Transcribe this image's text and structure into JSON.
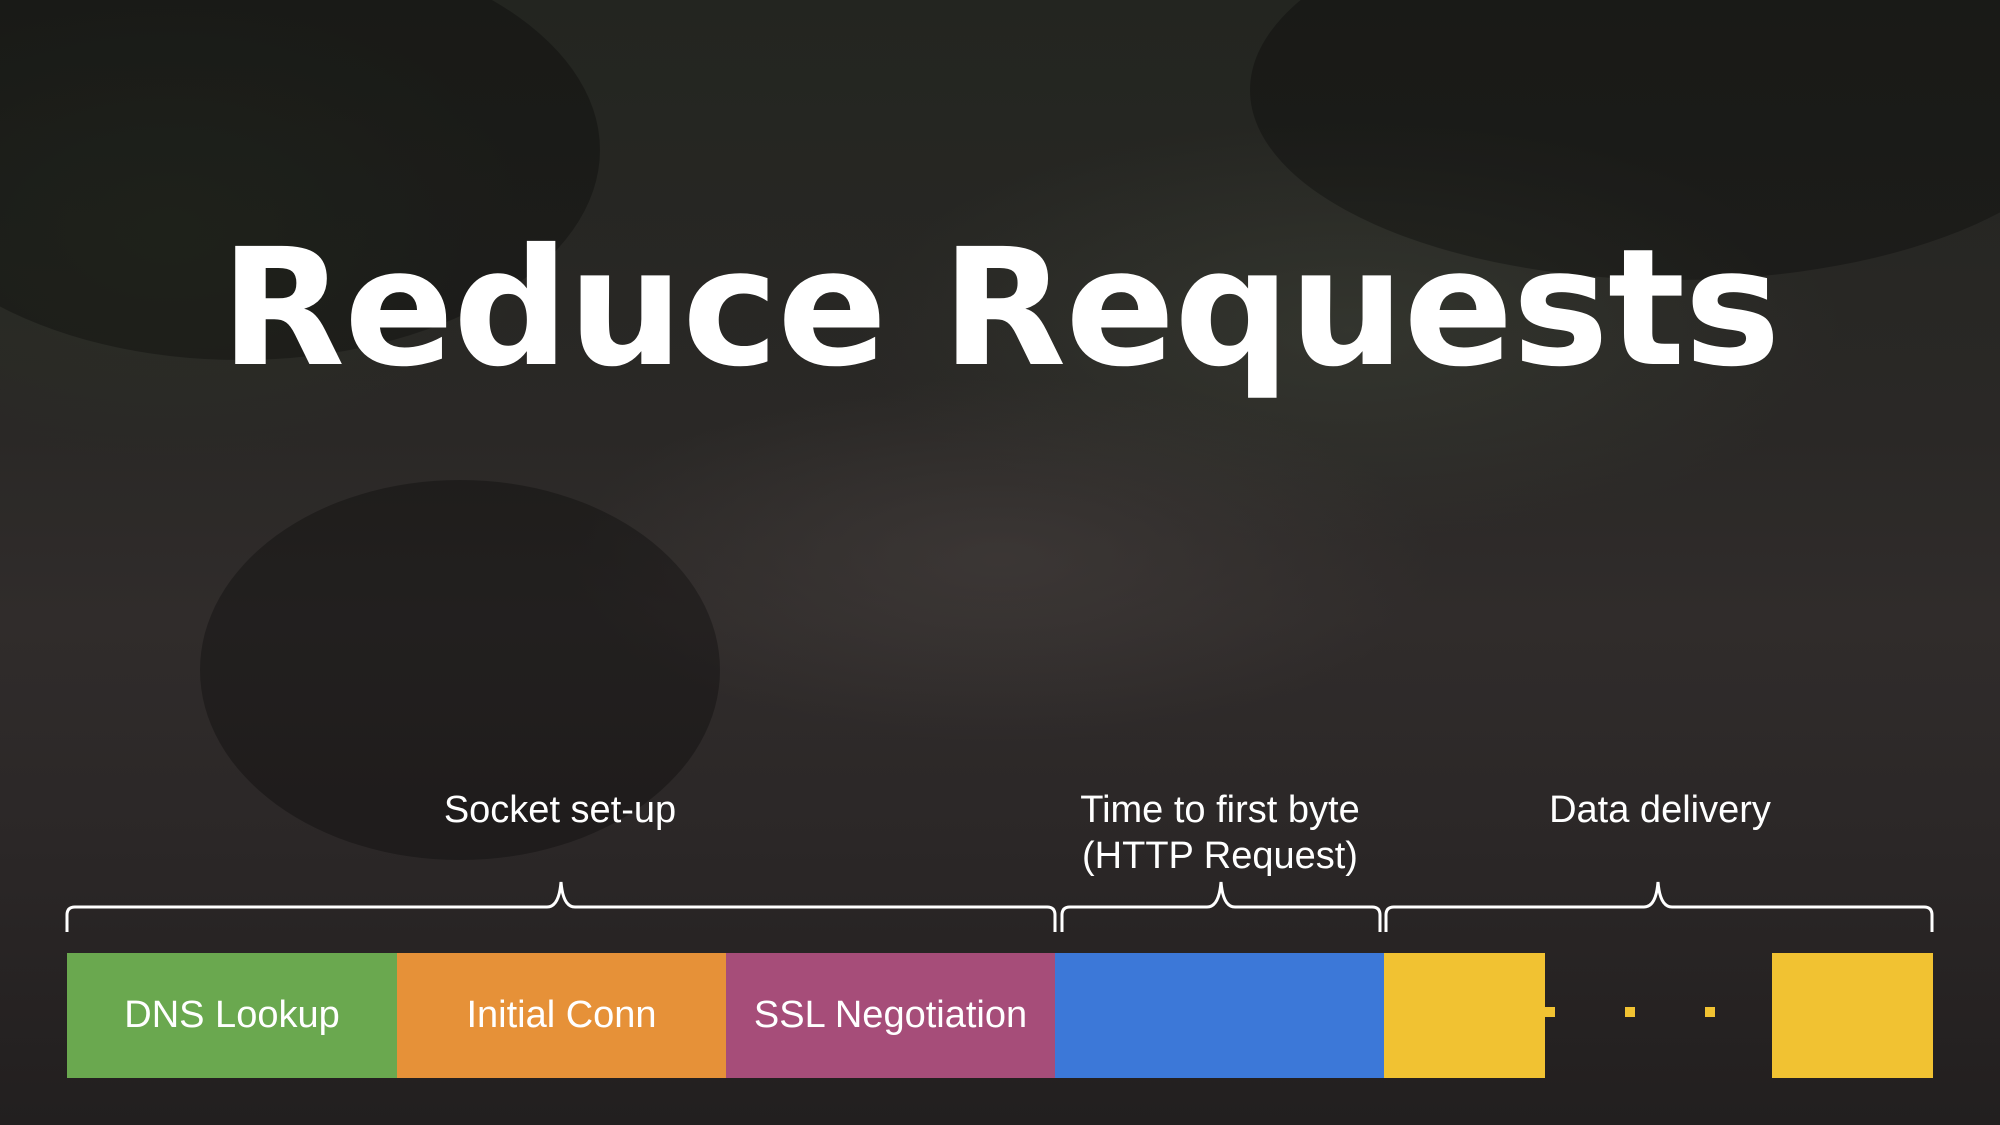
{
  "slide": {
    "title": "Reduce Requests"
  },
  "phases": [
    {
      "label": "Socket set-up"
    },
    {
      "label_line1": "Time to first byte",
      "label_line2": "(HTTP Request)"
    },
    {
      "label": "Data delivery"
    }
  ],
  "bars": [
    {
      "label": "DNS Lookup",
      "color": "#6aa84f"
    },
    {
      "label": "Initial Conn",
      "color": "#e69138"
    },
    {
      "label": "SSL Negotiation",
      "color": "#a64d79"
    },
    {
      "label": "",
      "color": "#3c78d8"
    },
    {
      "label": "",
      "color": "#f1c232"
    },
    {
      "label": "",
      "color": "#f1c232"
    }
  ],
  "ellipsis_icon": "ellipsis-dots"
}
